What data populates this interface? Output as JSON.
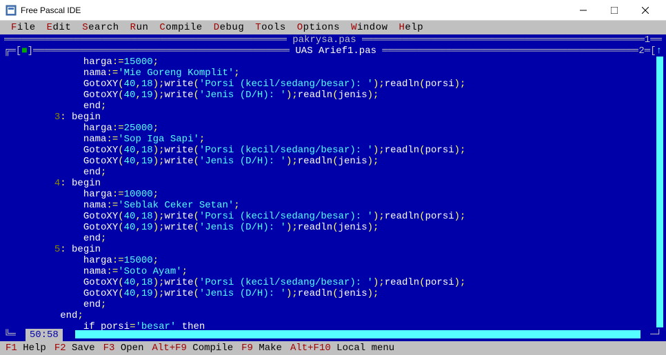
{
  "window": {
    "title": "Free Pascal IDE"
  },
  "menu": {
    "file": "File",
    "edit": "Edit",
    "search": "Search",
    "run": "Run",
    "compile": "Compile",
    "debug": "Debug",
    "tools": "Tools",
    "options": "Options",
    "window": "Window",
    "help": "Help"
  },
  "editor": {
    "tab_back": "pakrysa.pas",
    "tab_active": "UAS Arief1.pas",
    "tab_index_back": "1",
    "tab_index_active": "2",
    "cursor_pos": "50:58"
  },
  "code": {
    "lines": [
      {
        "indent": "            ",
        "tokens": [
          {
            "t": "harga",
            "c": "kw"
          },
          {
            "t": ":=",
            "c": "sym"
          },
          {
            "t": "15000",
            "c": "num"
          },
          {
            "t": ";",
            "c": "sym"
          }
        ]
      },
      {
        "indent": "            ",
        "tokens": [
          {
            "t": "nama",
            "c": "kw"
          },
          {
            "t": ":=",
            "c": "sym"
          },
          {
            "t": "'Mie Goreng Komplit'",
            "c": "str"
          },
          {
            "t": ";",
            "c": "sym"
          }
        ]
      },
      {
        "indent": "            ",
        "tokens": [
          {
            "t": "GotoXY",
            "c": "kw"
          },
          {
            "t": "(",
            "c": "sym"
          },
          {
            "t": "40",
            "c": "num"
          },
          {
            "t": ",",
            "c": "sym"
          },
          {
            "t": "18",
            "c": "num"
          },
          {
            "t": ");",
            "c": "sym"
          },
          {
            "t": "write",
            "c": "kw"
          },
          {
            "t": "(",
            "c": "sym"
          },
          {
            "t": "'Porsi (kecil/sedang/besar): '",
            "c": "str"
          },
          {
            "t": ");",
            "c": "sym"
          },
          {
            "t": "readln",
            "c": "kw"
          },
          {
            "t": "(",
            "c": "sym"
          },
          {
            "t": "porsi",
            "c": "kw"
          },
          {
            "t": ");",
            "c": "sym"
          }
        ]
      },
      {
        "indent": "            ",
        "tokens": [
          {
            "t": "GotoXY",
            "c": "kw"
          },
          {
            "t": "(",
            "c": "sym"
          },
          {
            "t": "40",
            "c": "num"
          },
          {
            "t": ",",
            "c": "sym"
          },
          {
            "t": "19",
            "c": "num"
          },
          {
            "t": ");",
            "c": "sym"
          },
          {
            "t": "write",
            "c": "kw"
          },
          {
            "t": "(",
            "c": "sym"
          },
          {
            "t": "'Jenis (D/H): '",
            "c": "str"
          },
          {
            "t": ");",
            "c": "sym"
          },
          {
            "t": "readln",
            "c": "kw"
          },
          {
            "t": "(",
            "c": "sym"
          },
          {
            "t": "jenis",
            "c": "kw"
          },
          {
            "t": ");",
            "c": "sym"
          }
        ]
      },
      {
        "indent": "            ",
        "tokens": [
          {
            "t": "end",
            "c": "kw"
          },
          {
            "t": ";",
            "c": "sym"
          }
        ]
      },
      {
        "indent": "        ",
        "lineno": "3",
        "tokens": [
          {
            "t": ": ",
            "c": "sym"
          },
          {
            "t": "begin",
            "c": "kw"
          }
        ]
      },
      {
        "indent": "            ",
        "tokens": [
          {
            "t": "harga",
            "c": "kw"
          },
          {
            "t": ":=",
            "c": "sym"
          },
          {
            "t": "25000",
            "c": "num"
          },
          {
            "t": ";",
            "c": "sym"
          }
        ]
      },
      {
        "indent": "            ",
        "tokens": [
          {
            "t": "nama",
            "c": "kw"
          },
          {
            "t": ":=",
            "c": "sym"
          },
          {
            "t": "'Sop Iga Sapi'",
            "c": "str"
          },
          {
            "t": ";",
            "c": "sym"
          }
        ]
      },
      {
        "indent": "            ",
        "tokens": [
          {
            "t": "GotoXY",
            "c": "kw"
          },
          {
            "t": "(",
            "c": "sym"
          },
          {
            "t": "40",
            "c": "num"
          },
          {
            "t": ",",
            "c": "sym"
          },
          {
            "t": "18",
            "c": "num"
          },
          {
            "t": ");",
            "c": "sym"
          },
          {
            "t": "write",
            "c": "kw"
          },
          {
            "t": "(",
            "c": "sym"
          },
          {
            "t": "'Porsi (kecil/sedang/besar): '",
            "c": "str"
          },
          {
            "t": ");",
            "c": "sym"
          },
          {
            "t": "readln",
            "c": "kw"
          },
          {
            "t": "(",
            "c": "sym"
          },
          {
            "t": "porsi",
            "c": "kw"
          },
          {
            "t": ");",
            "c": "sym"
          }
        ]
      },
      {
        "indent": "            ",
        "tokens": [
          {
            "t": "GotoXY",
            "c": "kw"
          },
          {
            "t": "(",
            "c": "sym"
          },
          {
            "t": "40",
            "c": "num"
          },
          {
            "t": ",",
            "c": "sym"
          },
          {
            "t": "19",
            "c": "num"
          },
          {
            "t": ");",
            "c": "sym"
          },
          {
            "t": "write",
            "c": "kw"
          },
          {
            "t": "(",
            "c": "sym"
          },
          {
            "t": "'Jenis (D/H): '",
            "c": "str"
          },
          {
            "t": ");",
            "c": "sym"
          },
          {
            "t": "readln",
            "c": "kw"
          },
          {
            "t": "(",
            "c": "sym"
          },
          {
            "t": "jenis",
            "c": "kw"
          },
          {
            "t": ");",
            "c": "sym"
          }
        ]
      },
      {
        "indent": "            ",
        "tokens": [
          {
            "t": "end",
            "c": "kw"
          },
          {
            "t": ";",
            "c": "sym"
          }
        ]
      },
      {
        "indent": "        ",
        "lineno": "4",
        "tokens": [
          {
            "t": ": ",
            "c": "sym"
          },
          {
            "t": "begin",
            "c": "kw"
          }
        ]
      },
      {
        "indent": "            ",
        "tokens": [
          {
            "t": "harga",
            "c": "kw"
          },
          {
            "t": ":=",
            "c": "sym"
          },
          {
            "t": "10000",
            "c": "num"
          },
          {
            "t": ";",
            "c": "sym"
          }
        ]
      },
      {
        "indent": "            ",
        "tokens": [
          {
            "t": "nama",
            "c": "kw"
          },
          {
            "t": ":=",
            "c": "sym"
          },
          {
            "t": "'Seblak Ceker Setan'",
            "c": "str"
          },
          {
            "t": ";",
            "c": "sym"
          }
        ]
      },
      {
        "indent": "            ",
        "tokens": [
          {
            "t": "GotoXY",
            "c": "kw"
          },
          {
            "t": "(",
            "c": "sym"
          },
          {
            "t": "40",
            "c": "num"
          },
          {
            "t": ",",
            "c": "sym"
          },
          {
            "t": "18",
            "c": "num"
          },
          {
            "t": ");",
            "c": "sym"
          },
          {
            "t": "write",
            "c": "kw"
          },
          {
            "t": "(",
            "c": "sym"
          },
          {
            "t": "'Porsi (kecil/sedang/besar): '",
            "c": "str"
          },
          {
            "t": ");",
            "c": "sym"
          },
          {
            "t": "readln",
            "c": "kw"
          },
          {
            "t": "(",
            "c": "sym"
          },
          {
            "t": "porsi",
            "c": "kw"
          },
          {
            "t": ");",
            "c": "sym"
          }
        ]
      },
      {
        "indent": "            ",
        "tokens": [
          {
            "t": "GotoXY",
            "c": "kw"
          },
          {
            "t": "(",
            "c": "sym"
          },
          {
            "t": "40",
            "c": "num"
          },
          {
            "t": ",",
            "c": "sym"
          },
          {
            "t": "19",
            "c": "num"
          },
          {
            "t": ");",
            "c": "sym"
          },
          {
            "t": "write",
            "c": "kw"
          },
          {
            "t": "(",
            "c": "sym"
          },
          {
            "t": "'Jenis (D/H): '",
            "c": "str"
          },
          {
            "t": ");",
            "c": "sym"
          },
          {
            "t": "readln",
            "c": "kw"
          },
          {
            "t": "(",
            "c": "sym"
          },
          {
            "t": "jenis",
            "c": "kw"
          },
          {
            "t": ");",
            "c": "sym"
          }
        ]
      },
      {
        "indent": "            ",
        "tokens": [
          {
            "t": "end",
            "c": "kw"
          },
          {
            "t": ";",
            "c": "sym"
          }
        ]
      },
      {
        "indent": "        ",
        "lineno": "5",
        "tokens": [
          {
            "t": ": ",
            "c": "sym"
          },
          {
            "t": "begin",
            "c": "kw"
          }
        ]
      },
      {
        "indent": "            ",
        "tokens": [
          {
            "t": "harga",
            "c": "kw"
          },
          {
            "t": ":=",
            "c": "sym"
          },
          {
            "t": "15000",
            "c": "num"
          },
          {
            "t": ";",
            "c": "sym"
          }
        ]
      },
      {
        "indent": "            ",
        "tokens": [
          {
            "t": "nama",
            "c": "kw"
          },
          {
            "t": ":=",
            "c": "sym"
          },
          {
            "t": "'Soto Ayam'",
            "c": "str"
          },
          {
            "t": ";",
            "c": "sym"
          }
        ]
      },
      {
        "indent": "            ",
        "tokens": [
          {
            "t": "GotoXY",
            "c": "kw"
          },
          {
            "t": "(",
            "c": "sym"
          },
          {
            "t": "40",
            "c": "num"
          },
          {
            "t": ",",
            "c": "sym"
          },
          {
            "t": "18",
            "c": "num"
          },
          {
            "t": ");",
            "c": "sym"
          },
          {
            "t": "write",
            "c": "kw"
          },
          {
            "t": "(",
            "c": "sym"
          },
          {
            "t": "'Porsi (kecil/sedang/besar): '",
            "c": "str"
          },
          {
            "t": ");",
            "c": "sym"
          },
          {
            "t": "readln",
            "c": "kw"
          },
          {
            "t": "(",
            "c": "sym"
          },
          {
            "t": "porsi",
            "c": "kw"
          },
          {
            "t": ");",
            "c": "sym"
          }
        ]
      },
      {
        "indent": "            ",
        "tokens": [
          {
            "t": "GotoXY",
            "c": "kw"
          },
          {
            "t": "(",
            "c": "sym"
          },
          {
            "t": "40",
            "c": "num"
          },
          {
            "t": ",",
            "c": "sym"
          },
          {
            "t": "19",
            "c": "num"
          },
          {
            "t": ");",
            "c": "sym"
          },
          {
            "t": "write",
            "c": "kw"
          },
          {
            "t": "(",
            "c": "sym"
          },
          {
            "t": "'Jenis (D/H): '",
            "c": "str"
          },
          {
            "t": ");",
            "c": "sym"
          },
          {
            "t": "readln",
            "c": "kw"
          },
          {
            "t": "(",
            "c": "sym"
          },
          {
            "t": "jenis",
            "c": "kw"
          },
          {
            "t": ");",
            "c": "sym"
          }
        ]
      },
      {
        "indent": "            ",
        "tokens": [
          {
            "t": "end",
            "c": "kw"
          },
          {
            "t": ";",
            "c": "sym"
          }
        ]
      },
      {
        "indent": "        ",
        "tokens": [
          {
            "t": "end",
            "c": "kw"
          },
          {
            "t": ";",
            "c": "sym"
          }
        ]
      },
      {
        "indent": "            ",
        "tokens": [
          {
            "t": "if",
            "c": "kw"
          },
          {
            "t": " porsi",
            "c": "kw"
          },
          {
            "t": "=",
            "c": "sym"
          },
          {
            "t": "'besar'",
            "c": "str"
          },
          {
            "t": " ",
            "c": "kw"
          },
          {
            "t": "then",
            "c": "kw"
          }
        ]
      }
    ]
  },
  "helpbar": {
    "items": [
      {
        "key": "F1",
        "label": "Help"
      },
      {
        "key": "F2",
        "label": "Save"
      },
      {
        "key": "F3",
        "label": "Open"
      },
      {
        "key": "Alt+F9",
        "label": "Compile"
      },
      {
        "key": "F9",
        "label": "Make"
      },
      {
        "key": "Alt+F10",
        "label": "Local menu"
      }
    ]
  }
}
